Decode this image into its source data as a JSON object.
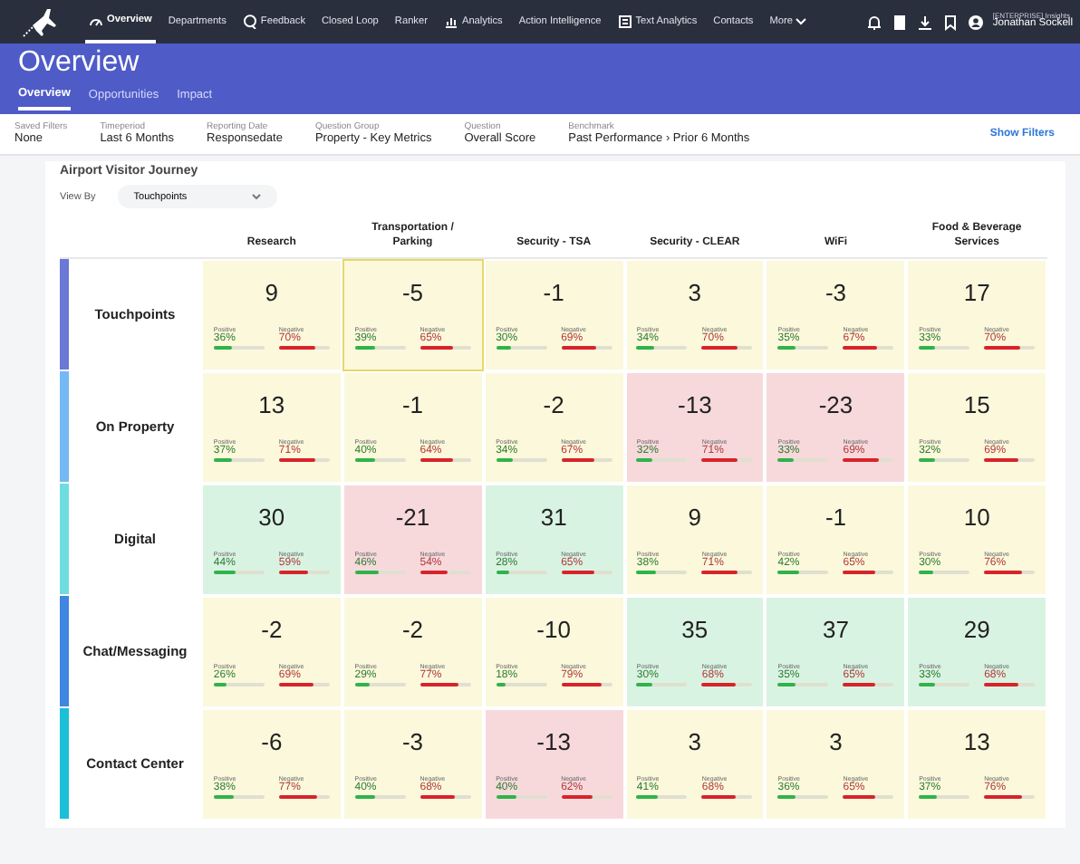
{
  "nav": {
    "items": [
      {
        "label": "Overview",
        "selected": true
      },
      {
        "label": "Departments",
        "selected": false
      },
      {
        "label": "Feedback",
        "selected": false
      },
      {
        "label": "Closed Loop",
        "selected": false
      },
      {
        "label": "Ranker",
        "selected": false
      },
      {
        "label": "Analytics",
        "selected": false
      },
      {
        "label": "Action Intelligence",
        "selected": false
      },
      {
        "label": "Text Analytics",
        "selected": false
      },
      {
        "label": "Contacts",
        "selected": false
      },
      {
        "label": "More",
        "selected": false
      }
    ],
    "user": {
      "org": "[ENTERPRISE] Insights",
      "name": "Jonathan Sockell"
    }
  },
  "header": {
    "title": "Overview",
    "tabs": [
      {
        "label": "Overview",
        "selected": true
      },
      {
        "label": "Opportunities",
        "selected": false
      },
      {
        "label": "Impact",
        "selected": false
      }
    ]
  },
  "filters": {
    "items": [
      {
        "label": "Saved Filters",
        "value": "None"
      },
      {
        "label": "Timeperiod",
        "value": "Last 6 Months"
      },
      {
        "label": "Reporting Date",
        "value": "Responsedate"
      },
      {
        "label": "Question Group",
        "value": "Property - Key Metrics"
      },
      {
        "label": "Question",
        "value": "Overall Score"
      },
      {
        "label": "Benchmark",
        "value": "Past Performance › Prior 6 Months"
      }
    ],
    "action": "Show Filters"
  },
  "card": {
    "title": "Airport Visitor Journey",
    "view_by": {
      "label": "View By",
      "value": "Touchpoints"
    },
    "columns": [
      "Research",
      "Transportation / Parking",
      "Security - TSA",
      "Security - CLEAR",
      "WiFi",
      "Food & Beverage Services"
    ],
    "rows": [
      {
        "label": "Touchpoints",
        "color": "#6b78d6",
        "cells": [
          {
            "score": "9",
            "kind": "neutral",
            "selected": false,
            "positive": {
              "label": "Positive",
              "value": "36%"
            },
            "negative": {
              "label": "Negative",
              "value": "70%"
            }
          },
          {
            "score": "-5",
            "kind": "neutral",
            "selected": true,
            "positive": {
              "label": "Positive",
              "value": "39%"
            },
            "negative": {
              "label": "Negative",
              "value": "65%"
            }
          },
          {
            "score": "-1",
            "kind": "neutral",
            "selected": false,
            "positive": {
              "label": "Positive",
              "value": "30%"
            },
            "negative": {
              "label": "Negative",
              "value": "69%"
            }
          },
          {
            "score": "3",
            "kind": "neutral",
            "selected": false,
            "positive": {
              "label": "Positive",
              "value": "34%"
            },
            "negative": {
              "label": "Negative",
              "value": "70%"
            }
          },
          {
            "score": "-3",
            "kind": "neutral",
            "selected": false,
            "positive": {
              "label": "Positive",
              "value": "35%"
            },
            "negative": {
              "label": "Negative",
              "value": "67%"
            }
          },
          {
            "score": "17",
            "kind": "neutral",
            "selected": false,
            "positive": {
              "label": "Positive",
              "value": "33%"
            },
            "negative": {
              "label": "Negative",
              "value": "70%"
            }
          }
        ]
      },
      {
        "label": "On Property",
        "color": "#74b9f4",
        "cells": [
          {
            "score": "13",
            "kind": "neutral",
            "selected": false,
            "positive": {
              "label": "Positive",
              "value": "37%"
            },
            "negative": {
              "label": "Negative",
              "value": "71%"
            }
          },
          {
            "score": "-1",
            "kind": "neutral",
            "selected": false,
            "positive": {
              "label": "Positive",
              "value": "40%"
            },
            "negative": {
              "label": "Negative",
              "value": "64%"
            }
          },
          {
            "score": "-2",
            "kind": "neutral",
            "selected": false,
            "positive": {
              "label": "Positive",
              "value": "34%"
            },
            "negative": {
              "label": "Negative",
              "value": "67%"
            }
          },
          {
            "score": "-13",
            "kind": "bad",
            "selected": false,
            "positive": {
              "label": "Positive",
              "value": "32%"
            },
            "negative": {
              "label": "Negative",
              "value": "71%"
            }
          },
          {
            "score": "-23",
            "kind": "bad",
            "selected": false,
            "positive": {
              "label": "Positive",
              "value": "33%"
            },
            "negative": {
              "label": "Negative",
              "value": "69%"
            }
          },
          {
            "score": "15",
            "kind": "neutral",
            "selected": false,
            "positive": {
              "label": "Positive",
              "value": "32%"
            },
            "negative": {
              "label": "Negative",
              "value": "69%"
            }
          }
        ]
      },
      {
        "label": "Digital",
        "color": "#6fdde0",
        "cells": [
          {
            "score": "30",
            "kind": "good",
            "selected": false,
            "positive": {
              "label": "Positive",
              "value": "44%"
            },
            "negative": {
              "label": "Negative",
              "value": "59%"
            }
          },
          {
            "score": "-21",
            "kind": "bad",
            "selected": false,
            "positive": {
              "label": "Positive",
              "value": "46%"
            },
            "negative": {
              "label": "Negative",
              "value": "54%"
            }
          },
          {
            "score": "31",
            "kind": "good",
            "selected": false,
            "positive": {
              "label": "Positive",
              "value": "28%"
            },
            "negative": {
              "label": "Negative",
              "value": "65%"
            }
          },
          {
            "score": "9",
            "kind": "neutral",
            "selected": false,
            "positive": {
              "label": "Positive",
              "value": "38%"
            },
            "negative": {
              "label": "Negative",
              "value": "71%"
            }
          },
          {
            "score": "-1",
            "kind": "neutral",
            "selected": false,
            "positive": {
              "label": "Positive",
              "value": "42%"
            },
            "negative": {
              "label": "Negative",
              "value": "65%"
            }
          },
          {
            "score": "10",
            "kind": "neutral",
            "selected": false,
            "positive": {
              "label": "Positive",
              "value": "30%"
            },
            "negative": {
              "label": "Negative",
              "value": "76%"
            }
          }
        ]
      },
      {
        "label": "Chat/Messaging",
        "color": "#3f87e3",
        "cells": [
          {
            "score": "-2",
            "kind": "neutral",
            "selected": false,
            "positive": {
              "label": "Positive",
              "value": "26%"
            },
            "negative": {
              "label": "Negative",
              "value": "69%"
            }
          },
          {
            "score": "-2",
            "kind": "neutral",
            "selected": false,
            "positive": {
              "label": "Positive",
              "value": "29%"
            },
            "negative": {
              "label": "Negative",
              "value": "77%"
            }
          },
          {
            "score": "-10",
            "kind": "neutral",
            "selected": false,
            "positive": {
              "label": "Positive",
              "value": "18%"
            },
            "negative": {
              "label": "Negative",
              "value": "79%"
            }
          },
          {
            "score": "35",
            "kind": "good",
            "selected": false,
            "positive": {
              "label": "Positive",
              "value": "30%"
            },
            "negative": {
              "label": "Negative",
              "value": "68%"
            }
          },
          {
            "score": "37",
            "kind": "good",
            "selected": false,
            "positive": {
              "label": "Positive",
              "value": "35%"
            },
            "negative": {
              "label": "Negative",
              "value": "65%"
            }
          },
          {
            "score": "29",
            "kind": "good",
            "selected": false,
            "positive": {
              "label": "Positive",
              "value": "33%"
            },
            "negative": {
              "label": "Negative",
              "value": "68%"
            }
          }
        ]
      },
      {
        "label": "Contact Center",
        "color": "#1cbfd8",
        "cells": [
          {
            "score": "-6",
            "kind": "neutral",
            "selected": false,
            "positive": {
              "label": "Positive",
              "value": "38%"
            },
            "negative": {
              "label": "Negative",
              "value": "77%"
            }
          },
          {
            "score": "-3",
            "kind": "neutral",
            "selected": false,
            "positive": {
              "label": "Positive",
              "value": "40%"
            },
            "negative": {
              "label": "Negative",
              "value": "68%"
            }
          },
          {
            "score": "-13",
            "kind": "bad",
            "selected": false,
            "positive": {
              "label": "Positive",
              "value": "40%"
            },
            "negative": {
              "label": "Negative",
              "value": "62%"
            }
          },
          {
            "score": "3",
            "kind": "neutral",
            "selected": false,
            "positive": {
              "label": "Positive",
              "value": "41%"
            },
            "negative": {
              "label": "Negative",
              "value": "68%"
            }
          },
          {
            "score": "3",
            "kind": "neutral",
            "selected": false,
            "positive": {
              "label": "Positive",
              "value": "36%"
            },
            "negative": {
              "label": "Negative",
              "value": "65%"
            }
          },
          {
            "score": "13",
            "kind": "neutral",
            "selected": false,
            "positive": {
              "label": "Positive",
              "value": "37%"
            },
            "negative": {
              "label": "Negative",
              "value": "76%"
            }
          }
        ]
      }
    ]
  }
}
